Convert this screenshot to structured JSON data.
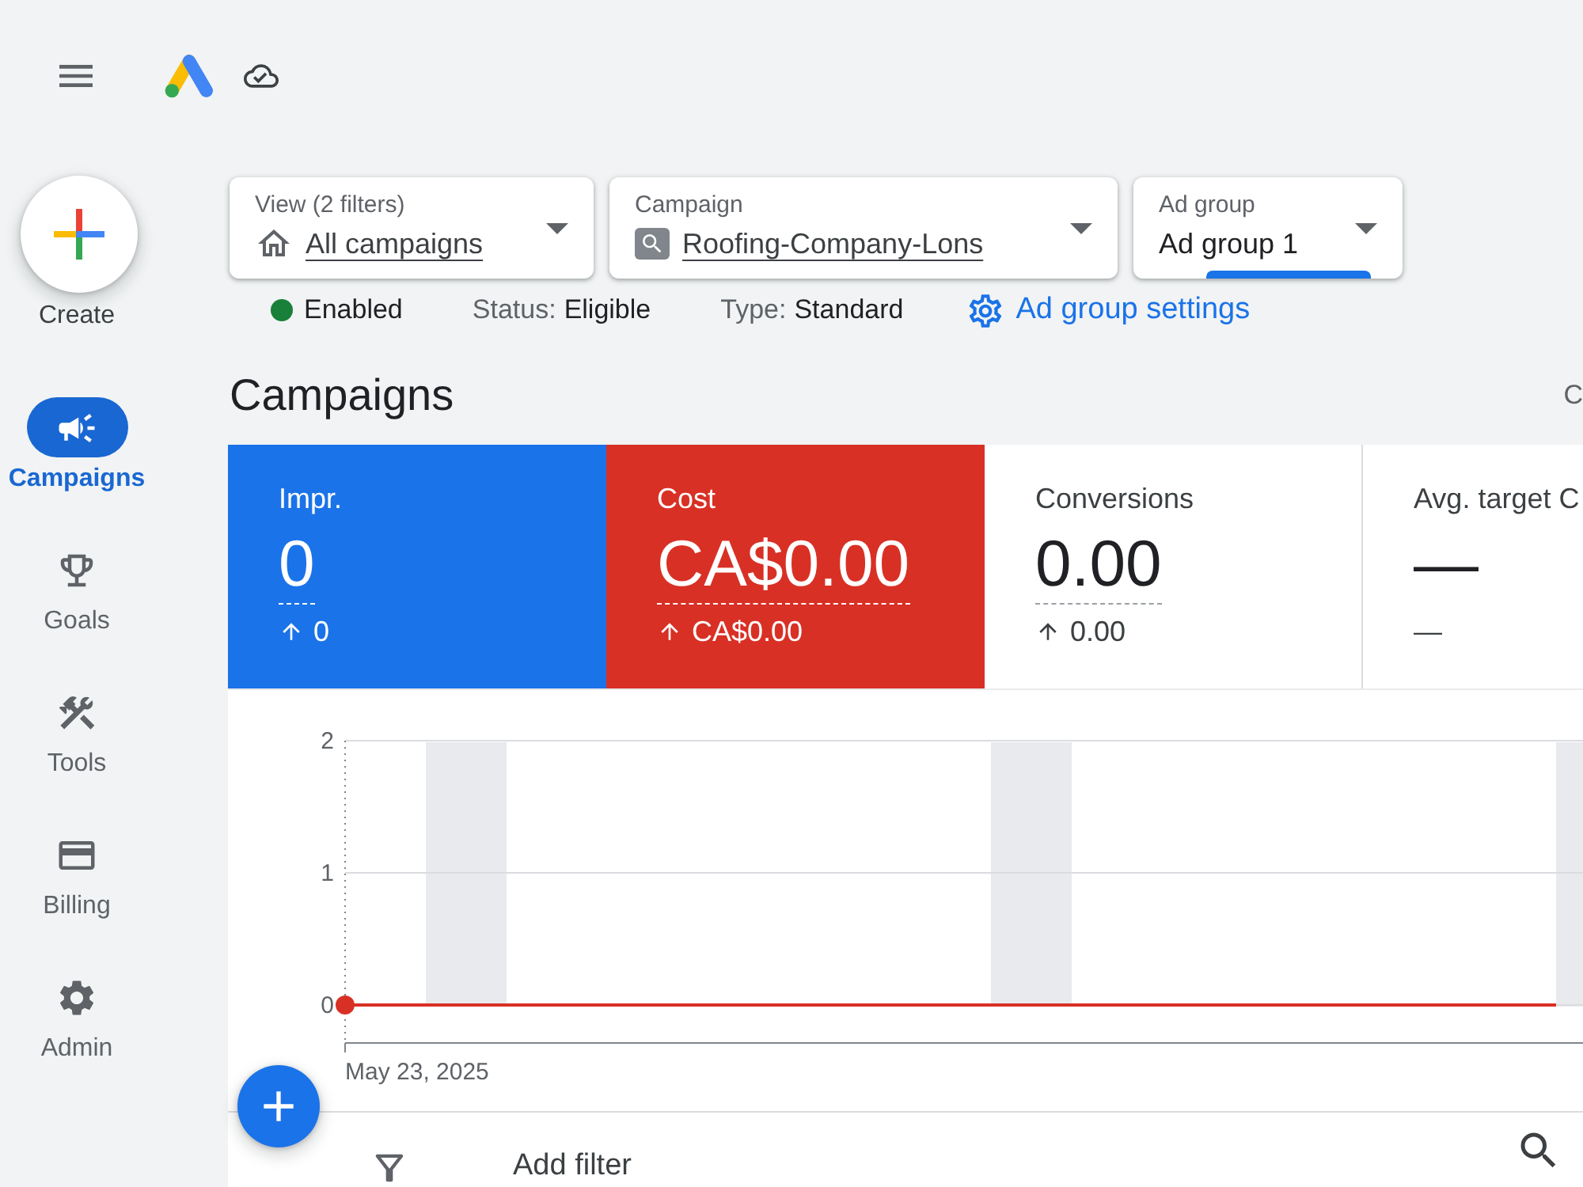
{
  "create": {
    "label": "Create"
  },
  "nav": [
    {
      "label": "Campaigns",
      "selected": true
    },
    {
      "label": "Goals",
      "selected": false
    },
    {
      "label": "Tools",
      "selected": false
    },
    {
      "label": "Billing",
      "selected": false
    },
    {
      "label": "Admin",
      "selected": false
    }
  ],
  "selectors": [
    {
      "kind": "view",
      "label": "View (2 filters)",
      "value": "All campaigns",
      "selected": false
    },
    {
      "kind": "campaign",
      "label": "Campaign",
      "value": "Roofing-Company-Lons",
      "selected": false
    },
    {
      "kind": "ad_group",
      "label": "Ad group",
      "value": "Ad group 1",
      "selected": true
    }
  ],
  "details": [
    {
      "kind": "status",
      "value": "Enabled",
      "color": "#188038"
    },
    {
      "kind": "field",
      "label": "Status:",
      "value": "Eligible"
    },
    {
      "kind": "field",
      "label": "Type:",
      "value": "Standard"
    },
    {
      "kind": "link",
      "value": "Ad group settings"
    }
  ],
  "page_title": "Campaigns",
  "overflow_text": "C",
  "metrics": [
    {
      "label": "Impr.",
      "value": "0",
      "change": "0",
      "increase": true,
      "selected": true,
      "color": "#1a73e8",
      "underlined": true
    },
    {
      "label": "Cost",
      "value": "CA$0.00",
      "change": "CA$0.00",
      "increase": true,
      "selected": true,
      "color": "#d93025",
      "underlined": true
    },
    {
      "label": "Conversions",
      "value": "0.00",
      "change": "0.00",
      "increase": true,
      "selected": false,
      "underlined": true
    },
    {
      "label": "Avg. target C",
      "value": "—",
      "change": "—",
      "increase": false,
      "selected": false,
      "underlined": false
    }
  ],
  "chart": {
    "chart_data": [
      {
        "type": "line",
        "categories": [
          null,
          null,
          null,
          null,
          null,
          null,
          null,
          null,
          null,
          null,
          null,
          null,
          null,
          null,
          null,
          null
        ],
        "values": [
          0,
          0,
          0,
          0,
          0,
          0,
          0,
          0,
          0,
          0,
          0,
          0,
          0,
          0,
          0,
          0
        ],
        "color": "#d93025",
        "ylim": [
          0,
          2
        ],
        "yticks": [
          {
            "value": 0,
            "label": "0"
          },
          {
            "value": 1,
            "label": "1"
          },
          {
            "value": 2,
            "label": "2"
          }
        ],
        "grid": true,
        "annotations": [
          "May 23, 2025"
        ]
      }
    ]
  },
  "filter_bar": {
    "placeholder": "Add filter"
  }
}
